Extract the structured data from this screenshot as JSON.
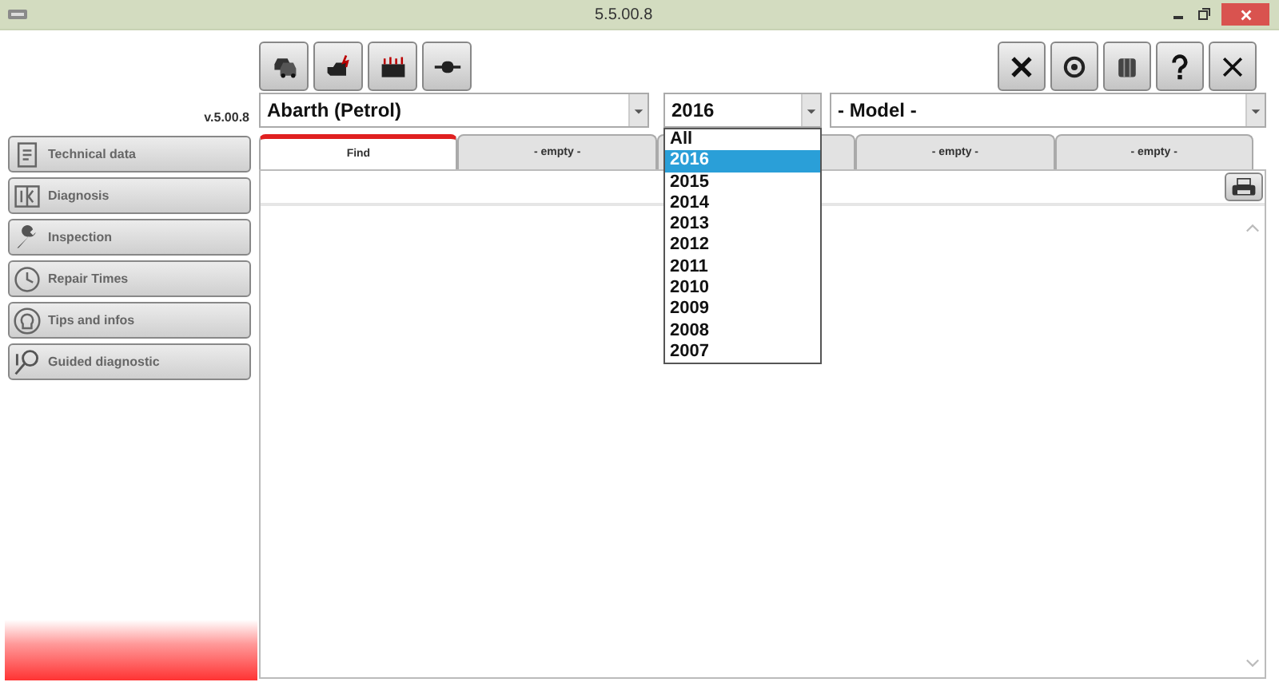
{
  "window": {
    "title": "5.5.00.8"
  },
  "version": "v.5.00.8",
  "selects": {
    "brand": "Abarth (Petrol)",
    "year": "2016",
    "model": "- Model -"
  },
  "year_dropdown": {
    "options": [
      {
        "label": "All",
        "selected": false
      },
      {
        "label": "2016",
        "selected": true
      },
      {
        "label": "2015",
        "selected": false
      },
      {
        "label": "2014",
        "selected": false
      },
      {
        "label": "2013",
        "selected": false
      },
      {
        "label": "2012",
        "selected": false
      },
      {
        "label": "2011",
        "selected": false
      },
      {
        "label": "2010",
        "selected": false
      },
      {
        "label": "2009",
        "selected": false
      },
      {
        "label": "2008",
        "selected": false
      },
      {
        "label": "2007",
        "selected": false
      }
    ]
  },
  "tabs": [
    {
      "label": "Find",
      "selected": true
    },
    {
      "label": "- empty -",
      "selected": false
    },
    {
      "selected": false
    },
    {
      "label": "- empty -",
      "selected": false
    },
    {
      "label": "- empty -",
      "selected": false
    }
  ],
  "sidebar": {
    "items": [
      {
        "label": "Technical data"
      },
      {
        "label": "Diagnosis"
      },
      {
        "label": "Inspection"
      },
      {
        "label": "Repair Times"
      },
      {
        "label": "Tips and infos"
      },
      {
        "label": "Guided diagnostic"
      }
    ]
  }
}
